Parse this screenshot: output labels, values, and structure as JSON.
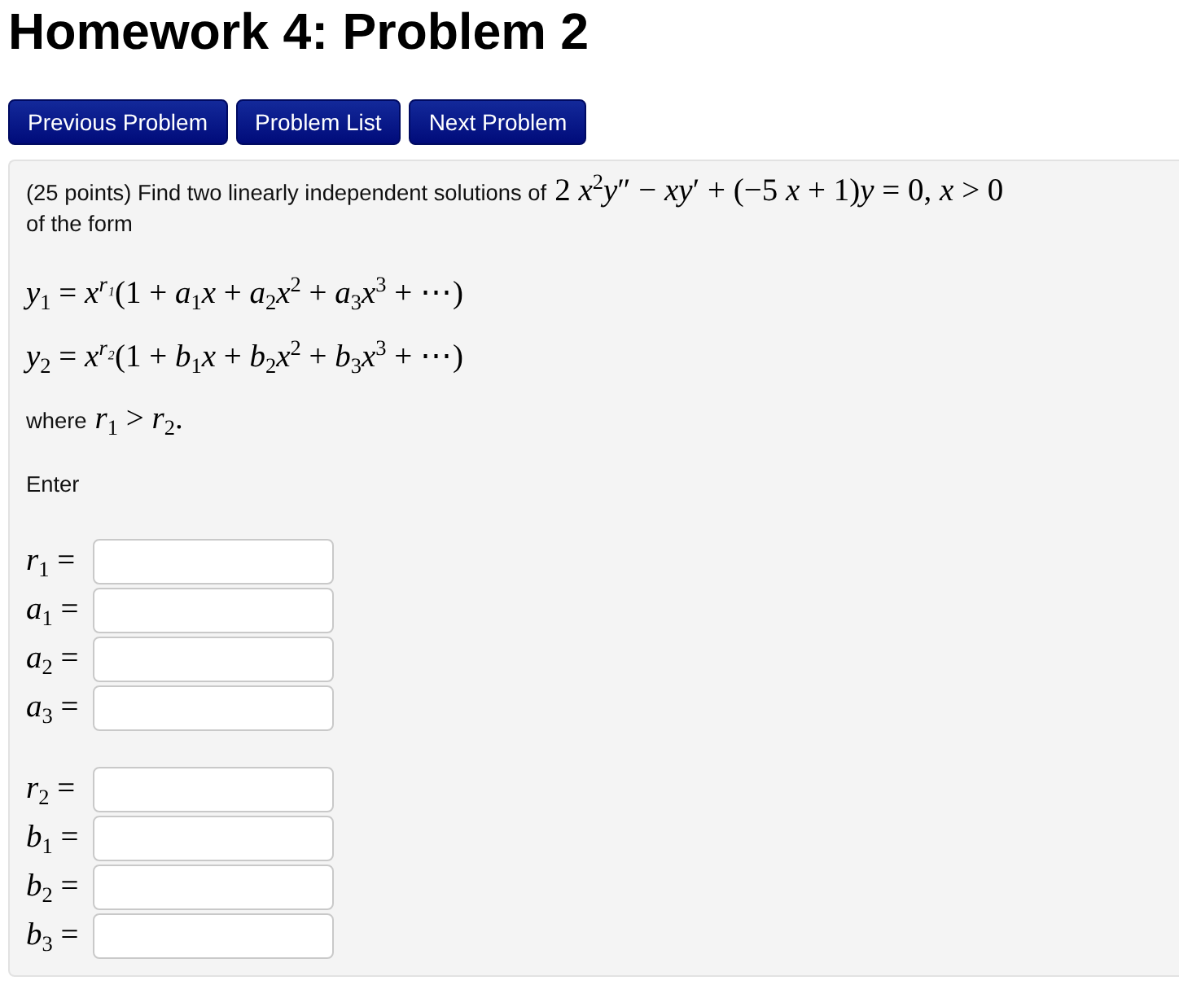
{
  "title": "Homework 4: Problem 2",
  "nav_buttons": [
    {
      "label": "Previous Problem"
    },
    {
      "label": "Problem List"
    },
    {
      "label": "Next Problem"
    }
  ],
  "problem": {
    "statement": "(25 points) Find two linearly independent solutions of",
    "equation": "2 *x*$^{2}$*y*″ − *xy*′ + (−5 *x* + 1)*y* = 0, *x* > 0",
    "statement_end": "of the form",
    "forms": [
      "*y*$_{1}$ = *x$^{r₁}$*(1 + *a*$_{1}$*x* + *a*$_{2}$*x*$^{2}$ + *a*$_{3}$*x*$^{3}$ + ⋯)",
      "*y*$_{2}$ = *x$^{r₂}$*(1 + *b*$_{1}$*x* + *b*$_{2}$*x*$^{2}$ + *b*$_{3}$*x*$^{3}$ + ⋯)"
    ],
    "condition_text": "where",
    "condition": "*r*$_{1}$ > *r*$_{2}$.",
    "prompt": "Enter",
    "answer_groups": [
      {
        "fields": [
          {
            "label": "*r*$_{1}$ ="
          },
          {
            "label": "*a*$_{1}$ ="
          },
          {
            "label": "*a*$_{2}$ ="
          },
          {
            "label": "*a*$_{3}$ ="
          }
        ]
      },
      {
        "fields": [
          {
            "label": "*r*$_{2}$ ="
          },
          {
            "label": "*b*$_{1}$ ="
          },
          {
            "label": "*b*$_{2}$ ="
          },
          {
            "label": "*b*$_{3}$ ="
          }
        ]
      }
    ]
  }
}
